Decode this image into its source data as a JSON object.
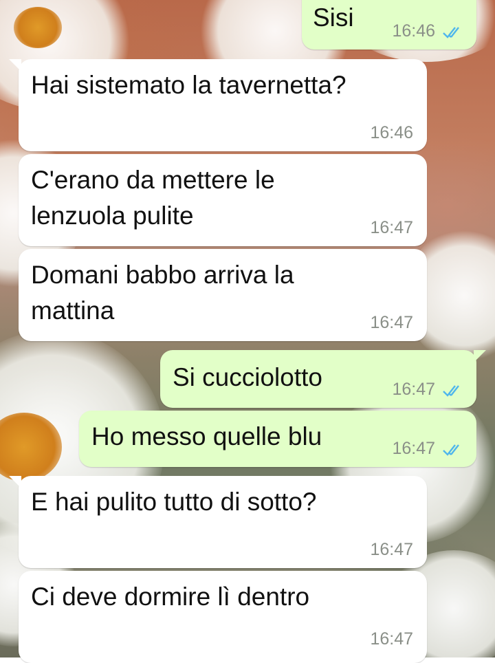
{
  "colors": {
    "incoming_bubble": "#ffffff",
    "outgoing_bubble": "#e2ffc8",
    "read_ticks": "#4fb6ec",
    "timestamp": "#8a8f88"
  },
  "messages": [
    {
      "direction": "outgoing",
      "text": "Sisi",
      "time": "16:46",
      "status_icon": "double-check-icon"
    },
    {
      "direction": "incoming",
      "text": "Hai sistemato la tavernetta?",
      "time": "16:46"
    },
    {
      "direction": "incoming",
      "text": "C'erano da mettere le\nlenzuola pulite",
      "time": "16:47"
    },
    {
      "direction": "incoming",
      "text": "Domani babbo arriva la\nmattina",
      "time": "16:47"
    },
    {
      "direction": "outgoing",
      "text": "Si cucciolotto",
      "time": "16:47",
      "status_icon": "double-check-icon"
    },
    {
      "direction": "outgoing",
      "text": "Ho messo quelle blu",
      "time": "16:47",
      "status_icon": "double-check-icon"
    },
    {
      "direction": "incoming",
      "text": "E hai pulito tutto di sotto?",
      "time": "16:47"
    },
    {
      "direction": "incoming",
      "text": "Ci deve dormire lì dentro",
      "time": "16:47"
    }
  ]
}
